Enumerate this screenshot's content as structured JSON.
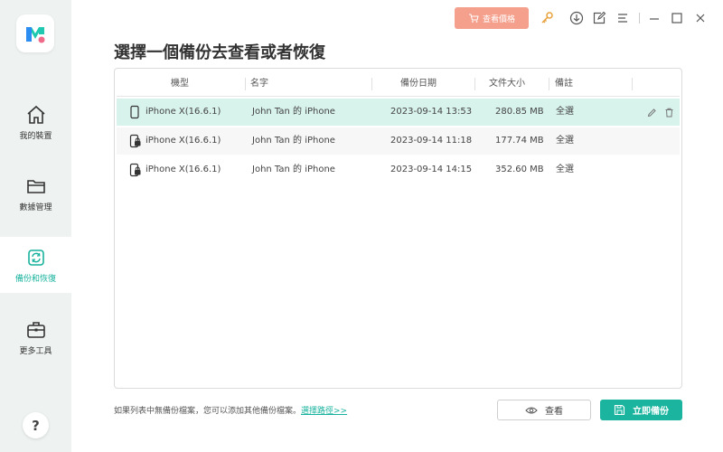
{
  "sidebar": {
    "items": [
      {
        "label": "我的裝置",
        "icon": "home-icon"
      },
      {
        "label": "數據管理",
        "icon": "folder-icon"
      },
      {
        "label": "備份和恢復",
        "icon": "backup-restore-icon"
      },
      {
        "label": "更多工具",
        "icon": "toolbox-icon"
      }
    ],
    "active_index": 2,
    "help_label": "?"
  },
  "topbar": {
    "price_label": "查看價格",
    "icons": [
      "key-icon",
      "download-icon",
      "edit-icon",
      "menu-icon",
      "minimize-icon",
      "maximize-icon",
      "close-icon"
    ]
  },
  "page_title": "選擇一個備份去查看或者恢復",
  "table": {
    "columns": [
      "機型",
      "名字",
      "備份日期",
      "文件大小",
      "備註"
    ],
    "rows": [
      {
        "model": "iPhone X(16.6.1)",
        "name": "John Tan 的 iPhone",
        "date": "2023-09-14 13:53",
        "size": "280.85 MB",
        "note": "全選",
        "locked": false
      },
      {
        "model": "iPhone X(16.6.1)",
        "name": "John Tan 的 iPhone",
        "date": "2023-09-14 11:18",
        "size": "177.74 MB",
        "note": "全選",
        "locked": true
      },
      {
        "model": "iPhone X(16.6.1)",
        "name": "John Tan 的 iPhone",
        "date": "2023-09-14 14:15",
        "size": "352.60 MB",
        "note": "全選",
        "locked": true
      }
    ]
  },
  "footer": {
    "hint": "如果列表中無備份檔案，您可以添加其他備份檔案。",
    "hint_link": "選擇路徑>>",
    "view_label": "查看",
    "backup_label": "立即備份"
  },
  "colors": {
    "accent": "#1bb59f",
    "price_button": "#f4a08c",
    "selected_row": "#d8f2ec",
    "sidebar_bg": "#eef2f1"
  }
}
